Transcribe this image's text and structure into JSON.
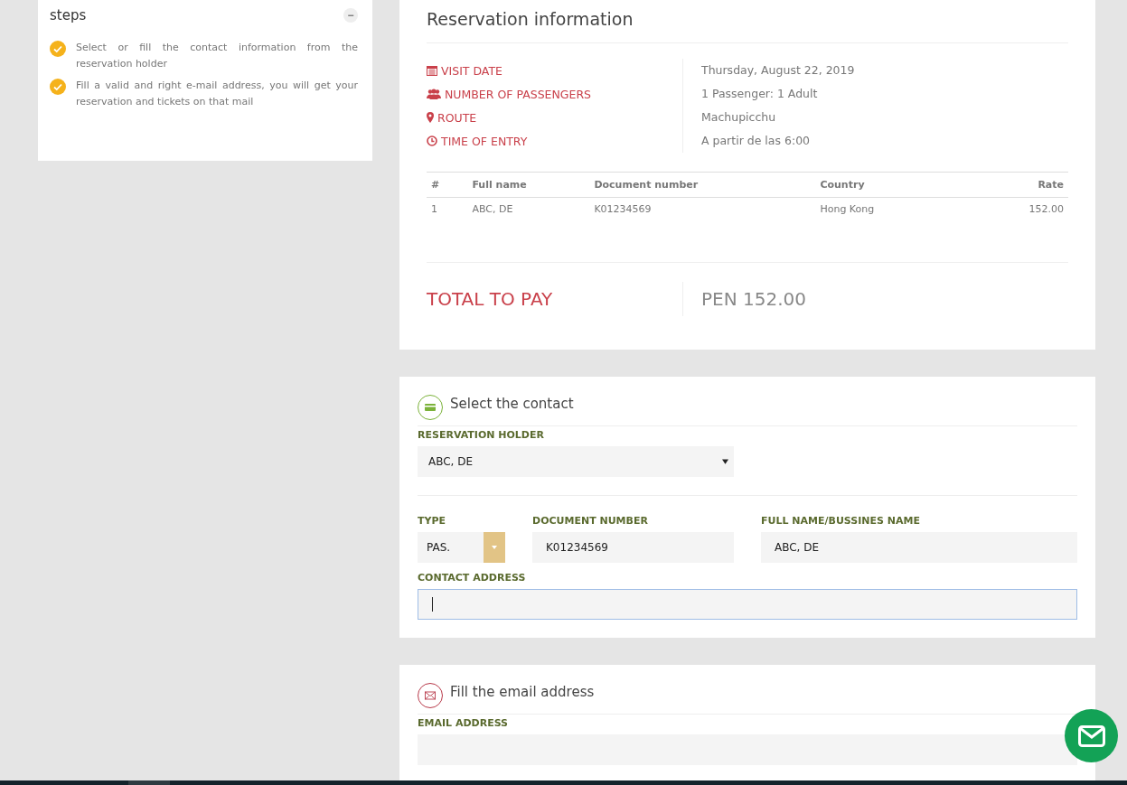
{
  "steps": {
    "title": "steps",
    "collapse_icon": "−",
    "items": [
      {
        "text": "Select or fill the contact information from the reservation holder",
        "checked": true
      },
      {
        "text": "Fill a valid and right e-mail address, you will get your reservation and tickets on that mail",
        "checked": true
      }
    ]
  },
  "reservation": {
    "title": "Reservation information",
    "details": [
      {
        "kind": "calendar",
        "label": "VISIT DATE",
        "value": "Thursday, August 22, 2019"
      },
      {
        "kind": "users",
        "label": "NUMBER OF PASSENGERS",
        "value": "1 Passenger: 1 Adult"
      },
      {
        "kind": "pin",
        "label": "ROUTE",
        "value": "Machupicchu"
      },
      {
        "kind": "clock",
        "label": "TIME OF ENTRY",
        "value": "A partir de las 6:00"
      }
    ],
    "table": {
      "columns": [
        "#",
        "Full name",
        "Document number",
        "Country",
        "Rate"
      ],
      "rows": [
        [
          "1",
          "ABC, DE",
          "K01234569",
          "Hong Kong",
          "152.00"
        ]
      ]
    },
    "total_label": "TOTAL TO PAY",
    "total_value": "PEN 152.00"
  },
  "contact": {
    "title": "Select the contact",
    "holder_label": "RESERVATION HOLDER",
    "holder_value": "ABC, DE",
    "type_label": "TYPE",
    "type_value": "PAS.",
    "doc_label": "DOCUMENT NUMBER",
    "doc_value": "K01234569",
    "name_label": "FULL NAME/BUSSINES NAME",
    "name_value": "ABC, DE",
    "address_label": "CONTACT ADDRESS"
  },
  "email": {
    "title": "Fill the email address",
    "label": "EMAIL ADDRESS"
  }
}
